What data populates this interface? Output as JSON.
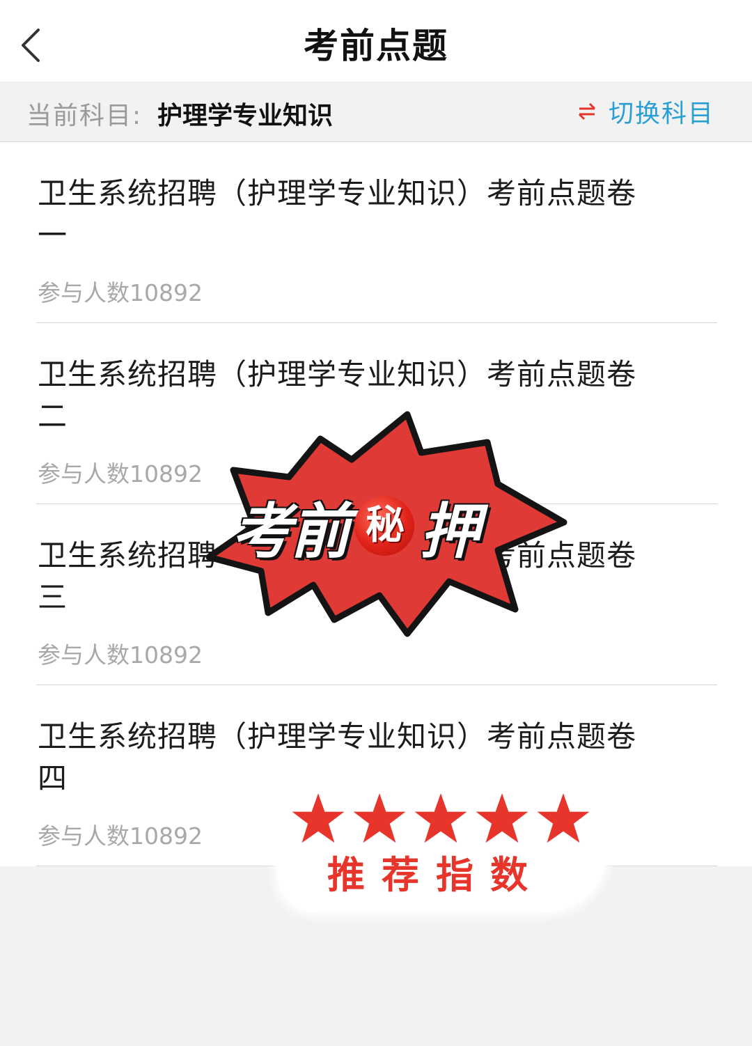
{
  "header": {
    "title": "考前点题",
    "back_icon": "chevron-left-icon"
  },
  "subject_bar": {
    "prefix": "当前科目:",
    "subject": "护理学专业知识",
    "switch_label": "切换科目",
    "switch_icon": "swap-arrows-icon",
    "switch_icon_color": "#e8352b",
    "switch_label_color": "#2a9fd6"
  },
  "papers": [
    {
      "title": "卫生系统招聘（护理学专业知识）考前点题卷一",
      "participants": "参与人数10892"
    },
    {
      "title": "卫生系统招聘（护理学专业知识）考前点题卷二",
      "participants": "参与人数10892"
    },
    {
      "title": "卫生系统招聘（护理学专业知识）考前点题卷三",
      "participants": "参与人数10892"
    },
    {
      "title": "卫生系统招聘（护理学专业知识）考前点题卷四",
      "participants": "参与人数10892"
    }
  ],
  "overlay": {
    "burst_text_a": "考前",
    "burst_secret": "秘",
    "burst_text_b": "押",
    "burst_color": "#e03a36",
    "rating_stars": 5,
    "rating_label": "推荐指数",
    "star_color": "#e8352b"
  }
}
